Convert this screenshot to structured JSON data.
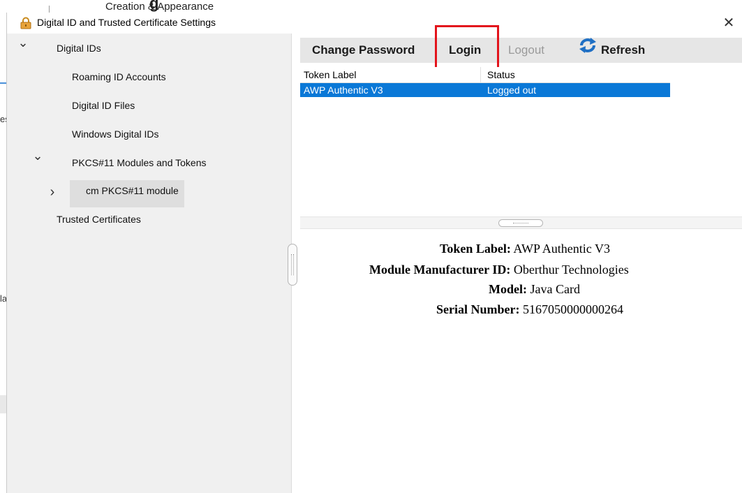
{
  "background_window": {
    "heading_fragment": "Creation & Appearance",
    "heading_glyph": "g",
    "left_fragments": [
      "es",
      "la"
    ]
  },
  "dialog": {
    "title": "Digital ID and Trusted Certificate Settings",
    "close_symbol": "✕",
    "icon": "lock-icon"
  },
  "tree": {
    "items": [
      {
        "label": "Digital IDs",
        "expanded": true
      },
      {
        "label": "Roaming ID Accounts"
      },
      {
        "label": "Digital ID Files"
      },
      {
        "label": "Windows Digital IDs"
      },
      {
        "label": "PKCS#11 Modules and Tokens",
        "expanded": true
      },
      {
        "label": "cm PKCS#11 module",
        "expanded": false,
        "selected": true
      },
      {
        "label": "Trusted Certificates"
      }
    ],
    "chevron_down": "⌄",
    "chevron_right": "›"
  },
  "toolbar": {
    "change_password": "Change Password",
    "login": "Login",
    "logout": "Logout",
    "refresh": "Refresh",
    "logout_disabled": true,
    "highlight_color": "#e3141c"
  },
  "token_table": {
    "headers": [
      "Token Label",
      "Status"
    ],
    "rows": [
      {
        "label": "AWP Authentic V3",
        "status": "Logged out",
        "selected": true
      }
    ],
    "selection_color": "#0a78d7"
  },
  "details": {
    "token_label_key": "Token Label:",
    "token_label_value": "AWP Authentic V3",
    "manufacturer_key": "Module Manufacturer ID:",
    "manufacturer_value": "Oberthur Technologies",
    "model_key": "Model:",
    "model_value": "Java Card",
    "serial_key": "Serial Number:",
    "serial_value": "5167050000000264"
  }
}
